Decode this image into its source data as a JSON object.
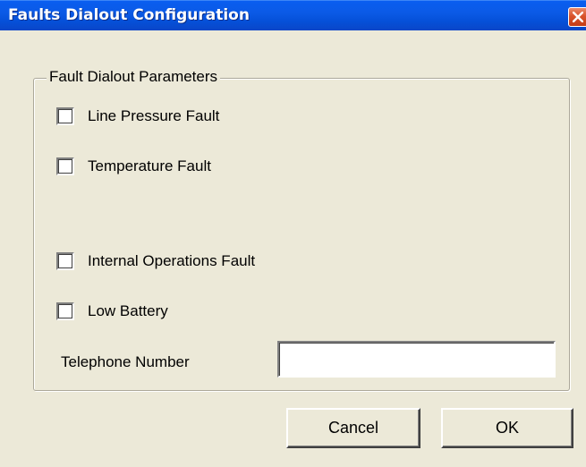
{
  "window": {
    "title": "Faults Dialout Configuration"
  },
  "group": {
    "legend": "Fault Dialout Parameters",
    "checkboxes": [
      {
        "label": "Line Pressure Fault",
        "checked": false
      },
      {
        "label": "Temperature Fault",
        "checked": false
      },
      {
        "label": "Internal Operations Fault",
        "checked": false
      },
      {
        "label": "Low Battery",
        "checked": false
      }
    ],
    "telephone": {
      "label": "Telephone Number",
      "value": ""
    }
  },
  "buttons": {
    "cancel_label": "Cancel",
    "ok_label": "OK"
  },
  "icons": {
    "close": "close-icon"
  },
  "colors": {
    "titlebar": "#0a5ef0",
    "close_button": "#d9532b",
    "dialog_background": "#ece9d8"
  }
}
